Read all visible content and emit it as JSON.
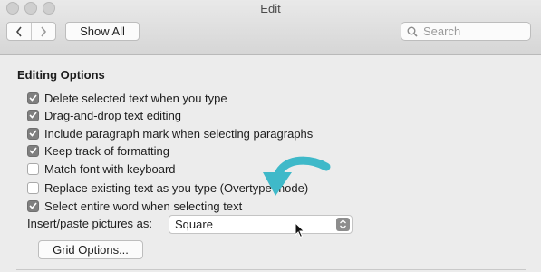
{
  "window": {
    "title": "Edit"
  },
  "toolbar": {
    "back_icon": "chevron-left-icon",
    "forward_icon": "chevron-right-icon",
    "show_all_label": "Show All",
    "search_placeholder": "Search"
  },
  "section": {
    "title": "Editing Options",
    "options": [
      {
        "label": "Delete selected text when you type",
        "checked": true
      },
      {
        "label": "Drag-and-drop text editing",
        "checked": true
      },
      {
        "label": "Include paragraph mark when selecting paragraphs",
        "checked": true
      },
      {
        "label": "Keep track of formatting",
        "checked": true
      },
      {
        "label": "Match font with keyboard",
        "checked": false
      },
      {
        "label": "Replace existing text as you type (Overtype mode)",
        "checked": false
      },
      {
        "label": "Select entire word when selecting text",
        "checked": true
      }
    ]
  },
  "insert_paste": {
    "label": "Insert/paste pictures as:",
    "selected": "Square"
  },
  "grid_button_label": "Grid Options...",
  "colors": {
    "overlay_arrow": "#3fb9c9",
    "checkbox_checked": "#7f7f7f"
  }
}
